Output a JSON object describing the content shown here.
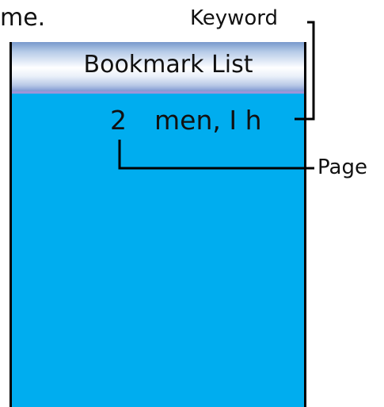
{
  "caption_fragment": "me.",
  "callouts": {
    "keyword": "Keyword",
    "page": "Page"
  },
  "screen": {
    "title": "Bookmark List",
    "background_color": "#00adef",
    "entries": [
      {
        "page": "2",
        "keyword": "men, I h"
      }
    ]
  }
}
